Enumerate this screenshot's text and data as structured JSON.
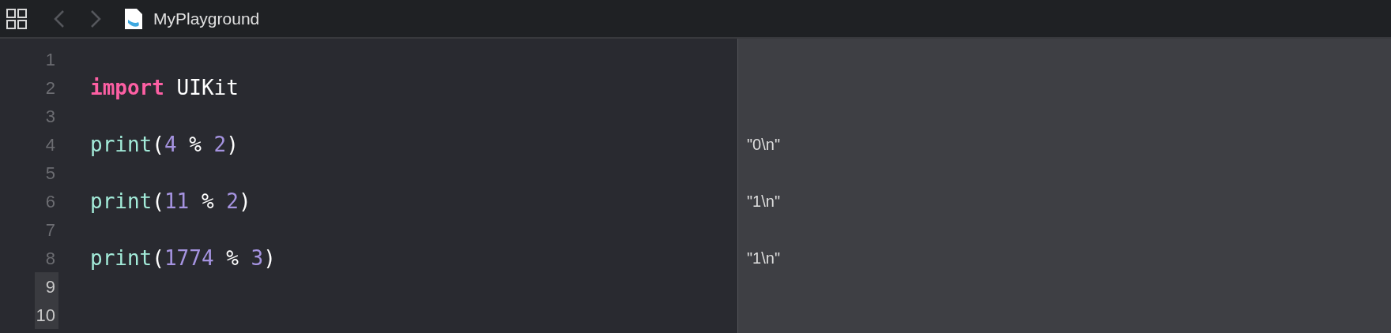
{
  "toolbar": {
    "title": "MyPlayground"
  },
  "editor": {
    "lines": [
      {
        "number": "1",
        "selected": false
      },
      {
        "number": "2",
        "selected": false,
        "tokens": [
          {
            "kind": "keyword",
            "text": "import"
          },
          {
            "kind": "plain",
            "text": " UIKit"
          }
        ]
      },
      {
        "number": "3",
        "selected": false
      },
      {
        "number": "4",
        "selected": false,
        "tokens": [
          {
            "kind": "function",
            "text": "print"
          },
          {
            "kind": "plain",
            "text": "("
          },
          {
            "kind": "number",
            "text": "4"
          },
          {
            "kind": "plain",
            "text": " % "
          },
          {
            "kind": "number",
            "text": "2"
          },
          {
            "kind": "plain",
            "text": ")"
          }
        ],
        "result": "\"0\\n\""
      },
      {
        "number": "5",
        "selected": false
      },
      {
        "number": "6",
        "selected": false,
        "tokens": [
          {
            "kind": "function",
            "text": "print"
          },
          {
            "kind": "plain",
            "text": "("
          },
          {
            "kind": "number",
            "text": "11"
          },
          {
            "kind": "plain",
            "text": " % "
          },
          {
            "kind": "number",
            "text": "2"
          },
          {
            "kind": "plain",
            "text": ")"
          }
        ],
        "result": "\"1\\n\""
      },
      {
        "number": "7",
        "selected": false
      },
      {
        "number": "8",
        "selected": false,
        "tokens": [
          {
            "kind": "function",
            "text": "print"
          },
          {
            "kind": "plain",
            "text": "("
          },
          {
            "kind": "number",
            "text": "1774"
          },
          {
            "kind": "plain",
            "text": " % "
          },
          {
            "kind": "number",
            "text": "3"
          },
          {
            "kind": "plain",
            "text": ")"
          }
        ],
        "result": "\"1\\n\""
      },
      {
        "number": "9",
        "selected": true
      },
      {
        "number": "10",
        "selected": true
      }
    ]
  }
}
